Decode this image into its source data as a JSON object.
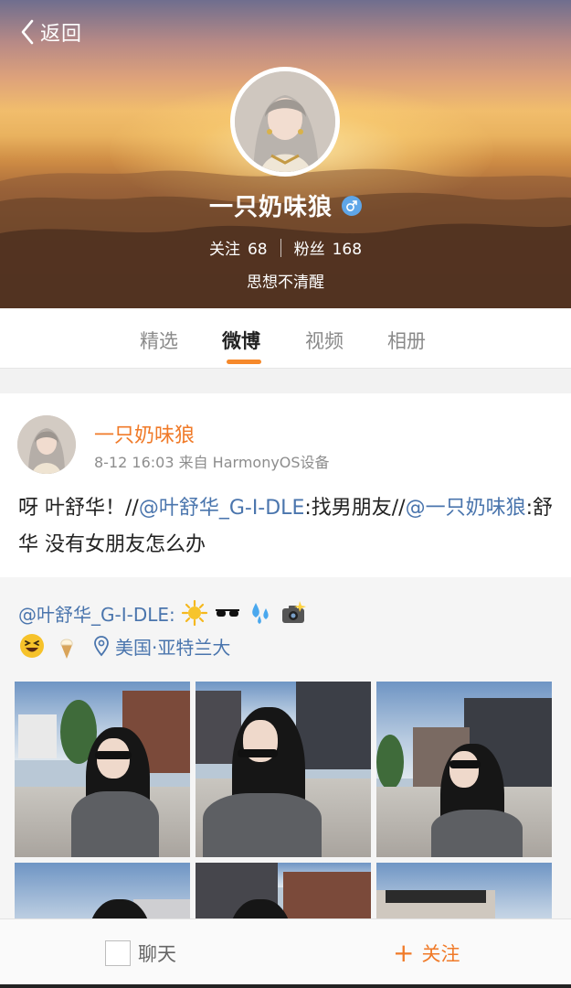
{
  "header": {
    "back_label": "返回",
    "user_name": "一只奶味狼",
    "gender_symbol": "♂",
    "following_label": "关注",
    "following_count": "68",
    "followers_label": "粉丝",
    "followers_count": "168",
    "bio": "思想不清醒"
  },
  "tabs": [
    {
      "label": "精选"
    },
    {
      "label": "微博"
    },
    {
      "label": "视频"
    },
    {
      "label": "相册"
    }
  ],
  "active_tab": "微博",
  "post": {
    "author": "一只奶味狼",
    "meta": "8-12 16:03 来自 HarmonyOS设备",
    "text_1": "呀 叶舒华！//",
    "mention_1": "@叶舒华_G-I-DLE",
    "text_2": ":找男朋友//",
    "mention_2": "@一只奶味狼",
    "text_3": ":舒华 没有女朋友怎么办",
    "repost": {
      "mention": "@叶舒华_G-I-DLE:",
      "emojis_line1": [
        "sun-emoji",
        "sunglasses-emoji",
        "sweat-droplets-emoji",
        "camera-flash-emoji"
      ],
      "emojis_line2": [
        "laughing-face-emoji",
        "ice-cream-emoji"
      ],
      "location": "美国·亚特兰大"
    }
  },
  "bottom_bar": {
    "chat_label": "聊天",
    "follow_label": "关注",
    "follow_plus": "+"
  },
  "colors": {
    "accent": "#f07a28",
    "tab_indicator": "#f6892b",
    "link": "#4a75ad",
    "gender_badge": "#5fa6e8"
  }
}
